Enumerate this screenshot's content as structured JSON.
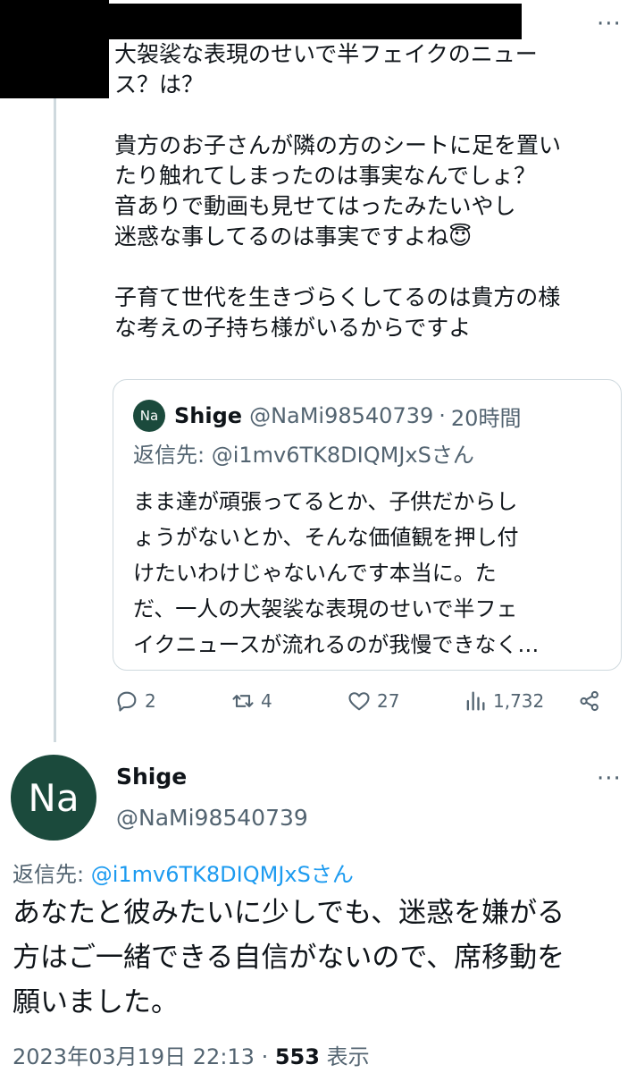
{
  "tweet1": {
    "text": "大袈裟な表現のせいで半フェイクのニュー\nス？は？\n\n貴方のお子さんが隣の方のシートに足を置い\nたり触れてしまったのは事実なんでしょ？\n音ありで動画も見せてはったみたいやし\n迷惑な事してるのは事実ですよね😇\n\n子育て世代を生きづらくしてるのは貴方の様\nな考えの子持ち様がいるからですよ",
    "more": "···",
    "quote": {
      "avatar_text": "Na",
      "name": "Shige",
      "handle": "@NaMi98540739",
      "dot": "·",
      "time": "20時間",
      "reply_to": "返信先: @i1mv6TK8DIQMJxSさん",
      "text": "まま達が頑張ってるとか、子供だからし\nょうがないとか、そんな価値観を押し付\nけたいわけじゃないんです本当に。た\nだ、一人の大袈裟な表現のせいで半フェ\nイクニュースが流れるのが我慢できなく…"
    },
    "actions": {
      "replies": "2",
      "retweets": "4",
      "likes": "27",
      "views": "1,732"
    }
  },
  "tweet2": {
    "avatar_text": "Na",
    "name": "Shige",
    "handle": "@NaMi98540739",
    "more": "···",
    "reply_label": "返信先: ",
    "reply_mention": "@i1mv6TK8DIQMJxSさん",
    "text": "あなたと彼みたいに少しでも、迷惑を嫌がる\n方はご一緒できる自信がないので、席移動を\n願いました。",
    "date": "2023年03月19日 22:13",
    "dot": " · ",
    "view_count": "553",
    "view_label": " 表示"
  },
  "icons": {
    "reply": "reply-icon",
    "retweet": "retweet-icon",
    "like": "heart-icon",
    "views": "views-icon",
    "share": "share-icon"
  },
  "colors": {
    "text": "#0f1419",
    "secondary": "#536471",
    "link": "#1d9bf0",
    "avatar_bg": "#1b4a3c",
    "border": "#cfd9de"
  }
}
